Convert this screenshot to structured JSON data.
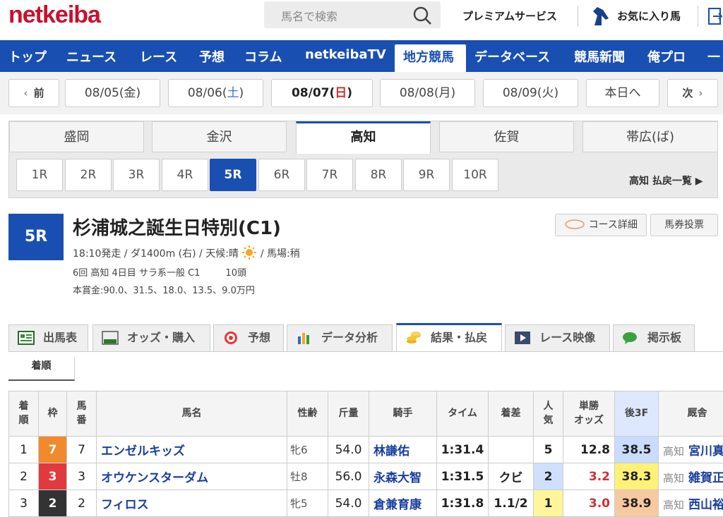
{
  "header": {
    "logo": "netkeiba",
    "search_placeholder": "馬名で検索",
    "premium": "プレミアムサービス",
    "favorites": "お気に入り馬"
  },
  "nav": [
    "トップ",
    "ニュース",
    "レース",
    "予想",
    "コラム",
    "netkeibaTV",
    "地方競馬",
    "データベース",
    "競馬新聞",
    "俺プロ",
    "一"
  ],
  "dates": {
    "prev": "前",
    "items": [
      {
        "date": "08/05(",
        "day": "金",
        ")": ")"
      },
      {
        "date": "08/06(",
        "day": "土",
        ")": ")"
      },
      {
        "date": "08/07(",
        "day": "日",
        ")": ")"
      },
      {
        "date": "08/08(",
        "day": "月",
        ")": ")"
      },
      {
        "date": "08/09(",
        "day": "火",
        ")": ")"
      }
    ],
    "today": "本日へ",
    "next": "次"
  },
  "tracks": [
    "盛岡",
    "金沢",
    "高知",
    "佐賀",
    "帯広(ば)"
  ],
  "races": [
    "1R",
    "2R",
    "3R",
    "4R",
    "5R",
    "6R",
    "7R",
    "8R",
    "9R",
    "10R"
  ],
  "payout_link": "高知 払戻一覧 ▶",
  "race": {
    "badge": "5R",
    "title": "杉浦城之誕生日特別(C1)",
    "line1a": "18:10発走 / ダ1400m (右) / 天候:晴",
    "line1b": "/ 馬場:稍",
    "line2a": "6回 高知 4日目 サラ系一般 C1",
    "line2b": "10頭",
    "line3": "本賞金:90.0、31.5、18.0、13.5、9.0万円"
  },
  "side_buttons": {
    "course": "コース詳細",
    "bet": "馬券投票"
  },
  "tabs": [
    "出馬表",
    "オッズ・購入",
    "予想",
    "データ分析",
    "結果・払戻",
    "レース映像",
    "掲示板"
  ],
  "subtab": "着順",
  "table": {
    "headers": [
      [
        "着",
        "順"
      ],
      [
        "枠"
      ],
      [
        "馬",
        "番"
      ],
      [
        "馬名"
      ],
      [
        "性齢"
      ],
      [
        "斤量"
      ],
      [
        "騎手"
      ],
      [
        "タイム"
      ],
      [
        "着差"
      ],
      [
        "人",
        "気"
      ],
      [
        "単勝",
        "オッズ"
      ],
      [
        "後3F"
      ],
      [
        "厩舎"
      ]
    ],
    "rows": [
      {
        "rank": "1",
        "waku": "7",
        "num": "7",
        "name": "エンゼルキッズ",
        "sex": "牝6",
        "weight": "54.0",
        "jockey": "林謙佑",
        "time": "1:31.4",
        "margin": "",
        "pop": "5",
        "odds": "12.8",
        "last3f": "38.5",
        "region": "高知",
        "trainer": "宮川真"
      },
      {
        "rank": "2",
        "waku": "3",
        "num": "3",
        "name": "オウケンスターダム",
        "sex": "牡8",
        "weight": "56.0",
        "jockey": "永森大智",
        "time": "1:31.5",
        "margin": "クビ",
        "pop": "2",
        "odds": "3.2",
        "last3f": "38.3",
        "region": "高知",
        "trainer": "雑賀正"
      },
      {
        "rank": "3",
        "waku": "2",
        "num": "2",
        "name": "フィロス",
        "sex": "牝5",
        "weight": "54.0",
        "jockey": "倉兼育康",
        "time": "1:31.8",
        "margin": "1.1/2",
        "pop": "1",
        "odds": "3.0",
        "last3f": "38.9",
        "region": "高知",
        "trainer": "西山裕"
      }
    ]
  },
  "colors": {
    "brand_red": "#c8102e",
    "nav_blue": "#1a4fb2",
    "waku7": "#f08a2c",
    "waku3": "#e03a3e",
    "waku2": "#333333",
    "pop1_bg": "#fff59a",
    "pop2_bg": "#cfe0ff",
    "f3_best": "#fff176",
    "f3_second": "#c9dcff",
    "f3_third": "#f6c9a0"
  }
}
